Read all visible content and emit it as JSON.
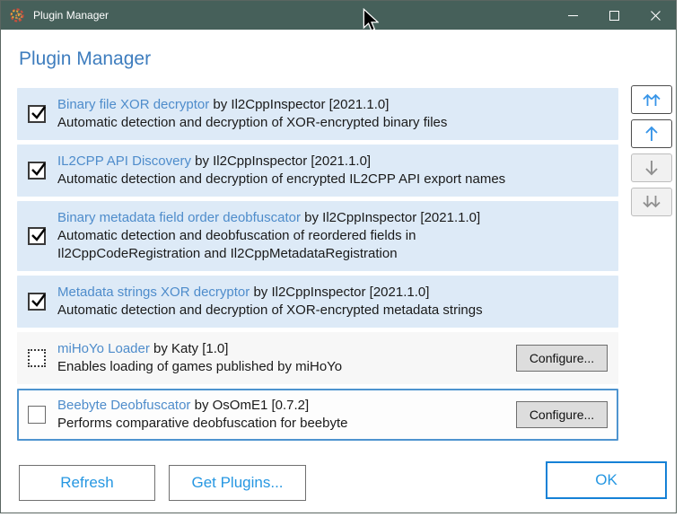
{
  "window": {
    "title": "Plugin Manager",
    "icons": {
      "app": "il2cpp-logo-icon",
      "titlebar": [
        "minimize-icon",
        "maximize-icon",
        "close-icon"
      ]
    }
  },
  "header": {
    "title": "Plugin Manager"
  },
  "plugins": [
    {
      "name": "Binary file XOR decryptor",
      "byline": "by Il2CppInspector [2021.1.0]",
      "description_lines": [
        "Automatic detection and decryption of XOR-encrypted binary files"
      ],
      "checkbox": "checked",
      "row_style": "highlight",
      "configure": null
    },
    {
      "name": "IL2CPP API Discovery",
      "byline": "by Il2CppInspector [2021.1.0]",
      "description_lines": [
        "Automatic detection and decryption of encrypted IL2CPP API export names"
      ],
      "checkbox": "checked",
      "row_style": "highlight",
      "configure": null
    },
    {
      "name": "Binary metadata field order deobfuscator",
      "byline": "by Il2CppInspector [2021.1.0]",
      "description_lines": [
        "Automatic detection and deobfuscation of reordered fields in",
        "Il2CppCodeRegistration and Il2CppMetadataRegistration"
      ],
      "checkbox": "checked",
      "row_style": "highlight",
      "configure": null
    },
    {
      "name": "Metadata strings XOR decryptor",
      "byline": "by Il2CppInspector [2021.1.0]",
      "description_lines": [
        "Automatic detection and decryption of XOR-encrypted metadata strings"
      ],
      "checkbox": "checked",
      "row_style": "highlight",
      "configure": null
    },
    {
      "name": "miHoYo Loader",
      "byline": "by Katy [1.0]",
      "description_lines": [
        "Enables loading of games published by miHoYo"
      ],
      "checkbox": "dotted",
      "row_style": "plain",
      "configure": "Configure..."
    },
    {
      "name": "Beebyte Deobfuscator",
      "byline": "by OsOmE1 [0.7.2]",
      "description_lines": [
        "Performs comparative deobfuscation for beebyte"
      ],
      "checkbox": "unchecked",
      "row_style": "selected",
      "configure": "Configure..."
    }
  ],
  "order_buttons": [
    {
      "icon": "move-to-top-icon",
      "state": "enabled"
    },
    {
      "icon": "move-up-icon",
      "state": "enabled"
    },
    {
      "icon": "move-down-icon",
      "state": "disabled"
    },
    {
      "icon": "move-to-bottom-icon",
      "state": "disabled"
    }
  ],
  "footer": {
    "refresh_label": "Refresh",
    "get_plugins_label": "Get Plugins...",
    "ok_label": "OK"
  },
  "colors": {
    "titlebar_bg": "#46605a",
    "heading_blue": "#3e7dbe",
    "plugin_name_blue": "#4e8ccb",
    "row_highlight_bg": "#ddeaf7",
    "row_plain_bg": "#f7f7f7",
    "selected_row_border": "#4e94cf",
    "action_blue": "#2697e2",
    "ok_border_blue": "#1581d6",
    "arrow_enabled_blue": "#3895e8",
    "arrow_disabled_gray": "#8f8f8f",
    "configure_bg": "#dddddd",
    "button_border_gray": "#707070"
  }
}
